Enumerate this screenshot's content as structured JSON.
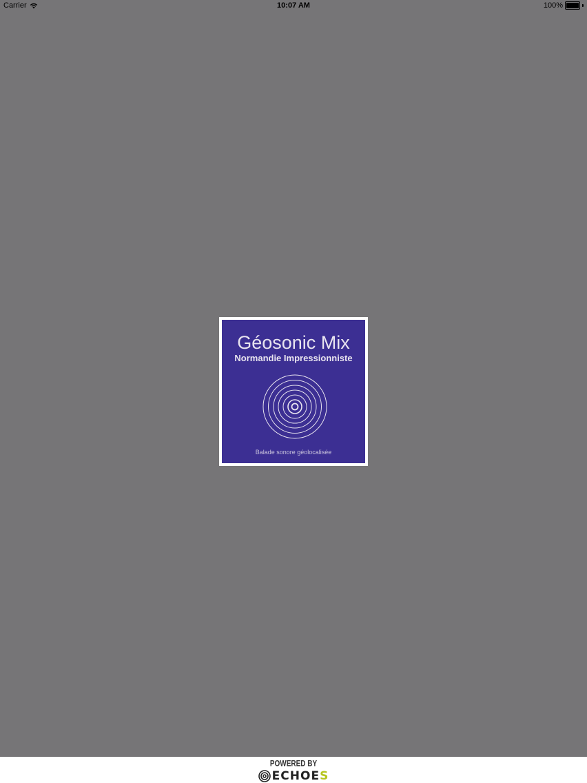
{
  "status_bar": {
    "carrier": "Carrier",
    "wifi_icon": "wifi-icon",
    "time": "10:07 AM",
    "battery_percent": "100%",
    "battery_level": 1.0
  },
  "splash": {
    "title": "Géosonic Mix",
    "subtitle": "Normandie Impressionniste",
    "tagline": "Balade sonore géolocalisée",
    "logo_icon": "concentric-rings-icon",
    "card_color": "#3c2f93",
    "border_color": "#ffffff"
  },
  "footer": {
    "powered_by": "POWERED BY",
    "brand_prefix": "ECHOE",
    "brand_suffix": "S",
    "brand_icon": "echoes-rings-icon",
    "accent_color": "#b6c61f"
  },
  "colors": {
    "background": "#767577"
  }
}
